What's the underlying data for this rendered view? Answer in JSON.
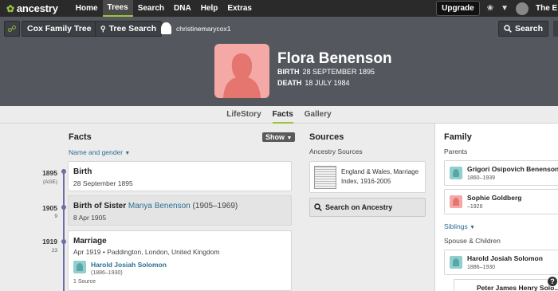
{
  "nav": {
    "brand": "ancestry",
    "links": [
      "Home",
      "Trees",
      "Search",
      "DNA",
      "Help",
      "Extras"
    ],
    "upgrade": "Upgrade",
    "account_cut": "The E"
  },
  "toolbar": {
    "tree_name": "Cox Family Tree",
    "tree_search": "Tree Search",
    "home_person": "christinemarycox1",
    "search": "Search"
  },
  "person": {
    "name": "Flora Benenson",
    "birth_label": "BIRTH",
    "birth_date": "28 SEPTEMBER 1895",
    "death_label": "DEATH",
    "death_date": "18 JULY 1984"
  },
  "tabs": [
    "LifeStory",
    "Facts",
    "Gallery"
  ],
  "facts": {
    "title": "Facts",
    "show_label": "Show",
    "filter_label": "Name and gender",
    "events": [
      {
        "year": "1895",
        "age": "(AGE)",
        "title": "Birth",
        "detail": "28 September 1895"
      },
      {
        "year": "1905",
        "age": "9",
        "title_prefix": "Birth of Sister",
        "relative": "Manya Benenson",
        "relative_dates": "(1905–1969)",
        "detail": "8 Apr 1905"
      },
      {
        "year": "1919",
        "age": "23",
        "title": "Marriage",
        "detail": "Apr 1919 • Paddington, London, United Kingdom",
        "spouse": "Harold Josiah Solomon",
        "spouse_dates": "(1886–1930)",
        "sources": "1 Source"
      }
    ]
  },
  "sources": {
    "title": "Sources",
    "subtitle": "Ancestry Sources",
    "item": "England & Wales, Marriage Index, 1916-2005",
    "search_label": "Search on Ancestry"
  },
  "family": {
    "title": "Family",
    "parents_label": "Parents",
    "parents": [
      {
        "name": "Grigori Osipovich Benenson",
        "dates": "1860–1939"
      },
      {
        "name": "Sophie Goldberg",
        "dates": "–1926"
      }
    ],
    "siblings_label": "Siblings",
    "spouse_label": "Spouse & Children",
    "spouse": {
      "name": "Harold Josiah Solomon",
      "dates": "1886–1930"
    },
    "child": {
      "name": "Peter James Henry Solo..."
    }
  },
  "colors": {
    "accent": "#9bc53d",
    "link": "#2a6f92",
    "female": "#f5a9a6",
    "male": "#8fcfcf",
    "timeline": "#6a6fa8"
  }
}
